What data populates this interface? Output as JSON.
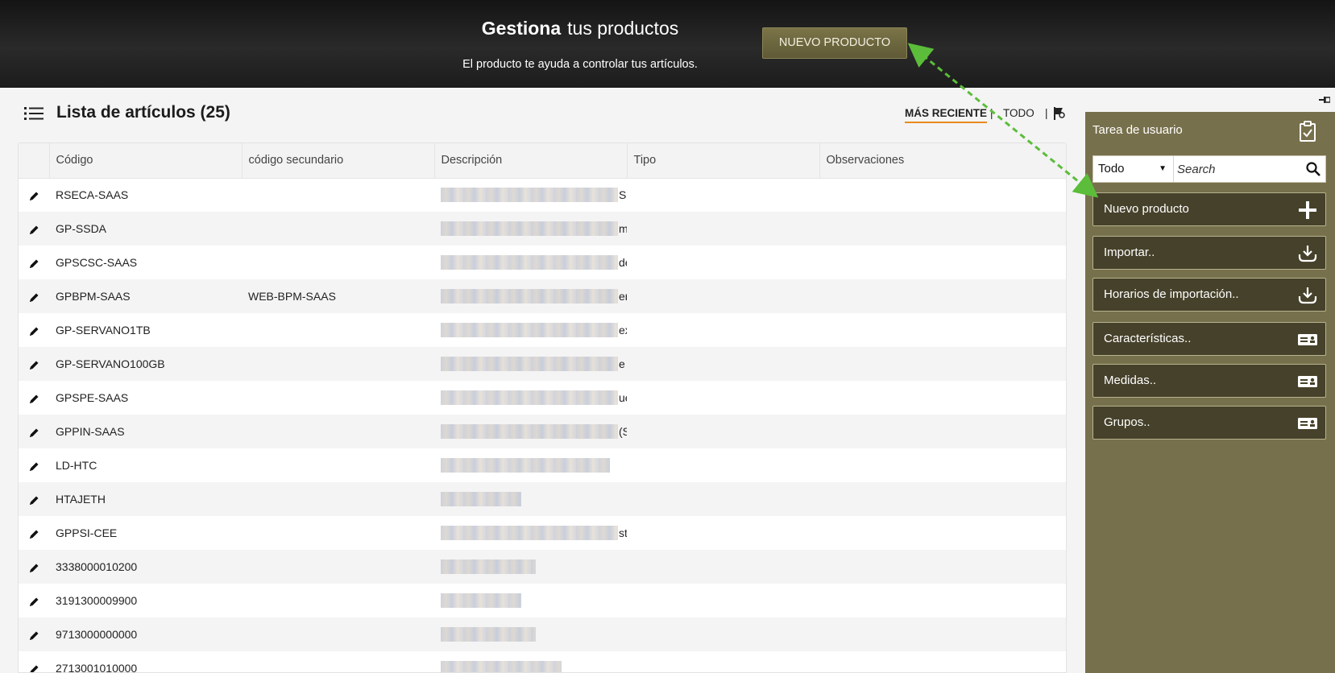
{
  "header": {
    "title_bold": "Gestiona",
    "title_rest": "tus productos",
    "subtitle": "El producto te ayuda a controlar tus artículos.",
    "new_product_button": "NUEVO PRODUCTO"
  },
  "list": {
    "title": "Lista de artículos (25)",
    "filter_recent": "MÁS RECIENTE",
    "filter_separator": "|",
    "filter_all": "TODO",
    "columns": [
      "",
      "Código",
      "código secundario",
      "Descripción",
      "Tipo",
      "Observaciones"
    ],
    "rows": [
      {
        "code": "RSECA-SAAS",
        "secondary": "",
        "desc_tail": "Se",
        "blur": 220
      },
      {
        "code": "GP-SSDA",
        "secondary": "",
        "desc_tail": "mi",
        "blur": 220
      },
      {
        "code": "GPSCSC-SAAS",
        "secondary": "",
        "desc_tail": "de",
        "blur": 220
      },
      {
        "code": "GPBPM-SAAS",
        "secondary": "WEB-BPM-SAAS",
        "desc_tail": "er",
        "blur": 220
      },
      {
        "code": "GP-SERVANO1TB",
        "secondary": "",
        "desc_tail": "ex",
        "blur": 220
      },
      {
        "code": "GP-SERVANO100GB",
        "secondary": "",
        "desc_tail": "e",
        "blur": 220
      },
      {
        "code": "GPSPE-SAAS",
        "secondary": "",
        "desc_tail": "ue",
        "blur": 220
      },
      {
        "code": "GPPIN-SAAS",
        "secondary": "",
        "desc_tail": "(S",
        "blur": 220
      },
      {
        "code": "LD-HTC",
        "secondary": "",
        "desc_tail": "",
        "blur": 210
      },
      {
        "code": "HTAJETH",
        "secondary": "",
        "desc_tail": "",
        "blur": 100
      },
      {
        "code": "GPPSI-CEE",
        "secondary": "",
        "desc_tail": "sta",
        "blur": 220
      },
      {
        "code": "3338000010200",
        "secondary": "",
        "desc_tail": "",
        "blur": 118
      },
      {
        "code": "3191300009900",
        "secondary": "",
        "desc_tail": "",
        "blur": 100
      },
      {
        "code": "9713000000000",
        "secondary": "",
        "desc_tail": "",
        "blur": 118
      },
      {
        "code": "2713001010000",
        "secondary": "",
        "desc_tail": "",
        "blur": 150
      }
    ]
  },
  "sidebar": {
    "title": "Tarea de usuario",
    "select_value": "Todo",
    "search_placeholder": "Search",
    "actions": [
      {
        "label": "Nuevo producto",
        "icon": "plus-icon"
      },
      {
        "label": "Importar..",
        "icon": "download-icon"
      },
      {
        "label": "Horarios de importación..",
        "icon": "download-icon"
      },
      {
        "label": "Características..",
        "icon": "id-card-icon"
      },
      {
        "label": "Medidas..",
        "icon": "id-card-icon"
      },
      {
        "label": "Grupos..",
        "icon": "id-card-icon"
      }
    ]
  },
  "colors": {
    "header_bg": "#1c1c1c",
    "button_olive": "#6e6840",
    "sidebar_bg": "#77704c",
    "action_bg": "#46412a",
    "active_underline": "#e88a1e",
    "arrow": "#5bbd3a"
  }
}
